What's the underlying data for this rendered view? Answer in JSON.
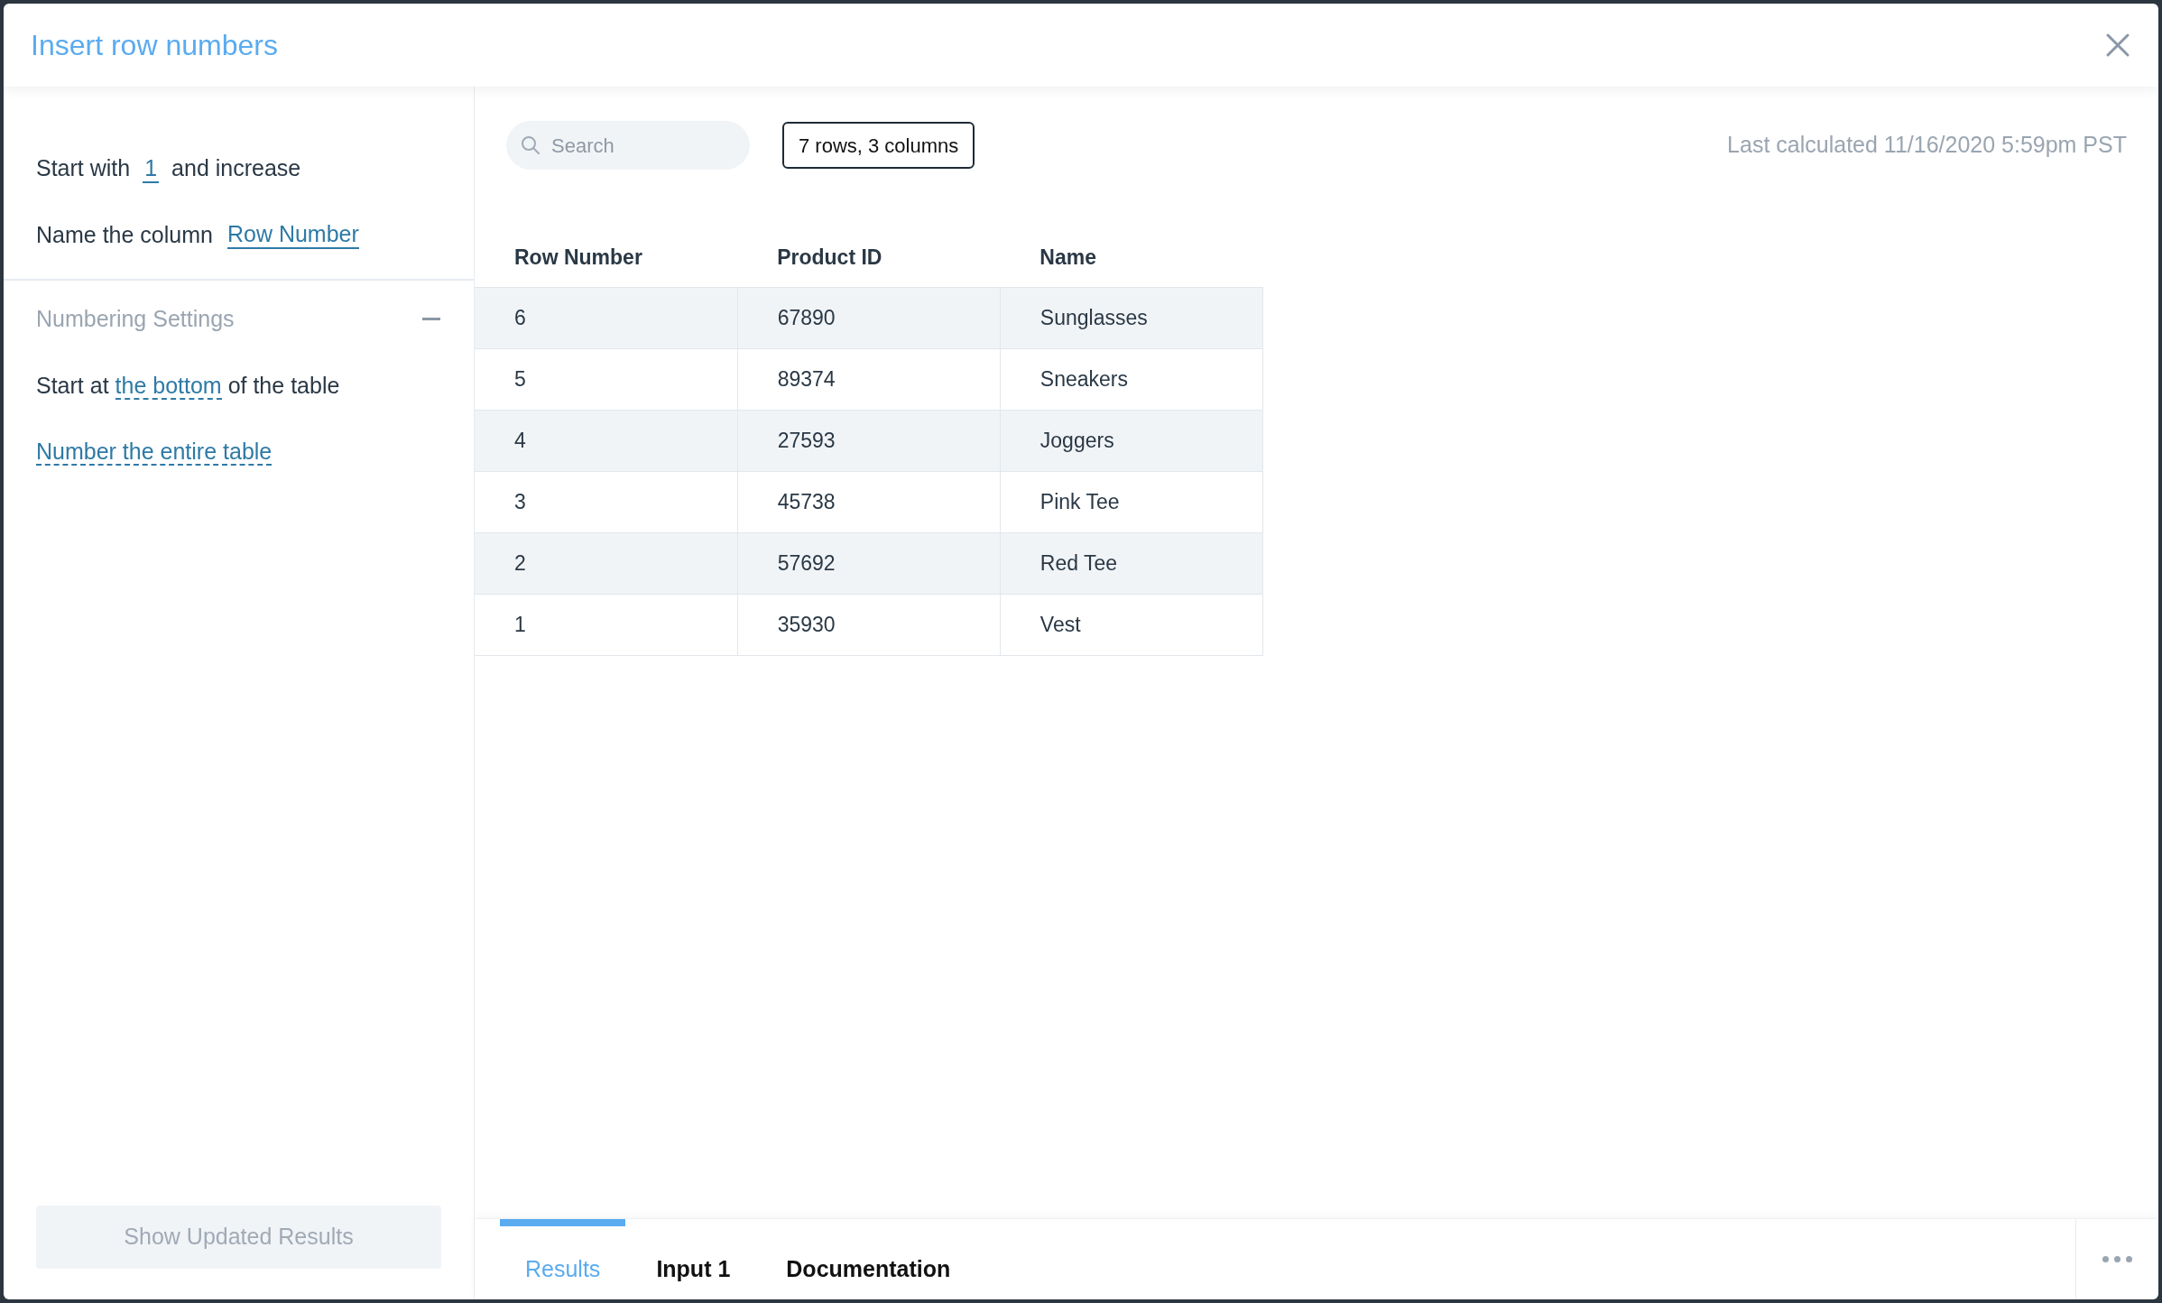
{
  "dialog": {
    "title": "Insert row numbers"
  },
  "settings": {
    "start_with": {
      "label_before": "Start with",
      "value": "1",
      "label_after": "and increase"
    },
    "name_column": {
      "label": "Name the column",
      "value": "Row Number"
    }
  },
  "numbering_settings": {
    "title": "Numbering Settings",
    "expanded": true,
    "options": [
      {
        "kind": "sentence",
        "before": "Start at",
        "link": "the bottom",
        "after": "of the table"
      },
      {
        "kind": "link",
        "link": "Number the entire table"
      }
    ]
  },
  "apply_button": {
    "label": "Show Updated Results",
    "disabled": true
  },
  "toolbar": {
    "search": {
      "placeholder": "Search"
    },
    "summary": "7 rows, 3 columns",
    "last_calculated": "Last calculated 11/16/2020 5:59pm PST"
  },
  "table": {
    "columns": [
      "Row Number",
      "Product ID",
      "Name"
    ],
    "rows": [
      [
        "6",
        "67890",
        "Sunglasses"
      ],
      [
        "5",
        "89374",
        "Sneakers"
      ],
      [
        "4",
        "27593",
        "Joggers"
      ],
      [
        "3",
        "45738",
        "Pink Tee"
      ],
      [
        "2",
        "57692",
        "Red Tee"
      ],
      [
        "1",
        "35930",
        "Vest"
      ]
    ]
  },
  "bottom_tabs": [
    {
      "label": "Results",
      "selected": true
    },
    {
      "label": "Input 1",
      "selected": false
    },
    {
      "label": "Documentation",
      "selected": false
    }
  ]
}
